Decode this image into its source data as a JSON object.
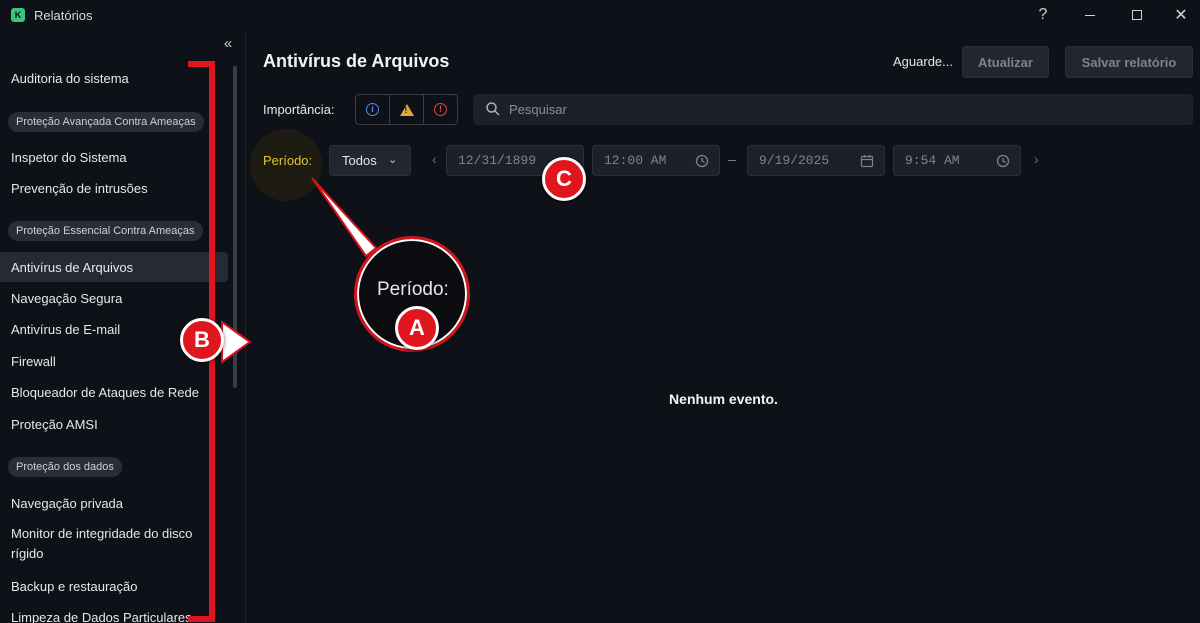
{
  "window": {
    "title": "Relatórios",
    "logo_letter": "K",
    "help_label": "?",
    "close_label": "✕"
  },
  "sidebar": {
    "collapse_label": "«",
    "items": [
      {
        "type": "item",
        "label": "Auditoria do sistema"
      },
      {
        "type": "group",
        "label": "Proteção Avançada Contra Ameaças"
      },
      {
        "type": "item",
        "label": "Inspetor do Sistema"
      },
      {
        "type": "item",
        "label": "Prevenção de intrusões"
      },
      {
        "type": "group",
        "label": "Proteção Essencial Contra Ameaças"
      },
      {
        "type": "item",
        "label": "Antivírus de Arquivos",
        "active": true
      },
      {
        "type": "item",
        "label": "Navegação Segura"
      },
      {
        "type": "item",
        "label": "Antivírus de E-mail"
      },
      {
        "type": "item",
        "label": "Firewall"
      },
      {
        "type": "item",
        "label": "Bloqueador de Ataques de Rede"
      },
      {
        "type": "item",
        "label": "Proteção AMSI"
      },
      {
        "type": "group",
        "label": "Proteção dos dados"
      },
      {
        "type": "item",
        "label": "Navegação privada"
      },
      {
        "type": "item",
        "label": "Monitor de integridade do disco rígido"
      },
      {
        "type": "item",
        "label": "Backup e restauração"
      },
      {
        "type": "item",
        "label": "Limpeza de Dados Particulares"
      }
    ]
  },
  "main": {
    "title": "Antivírus de Arquivos",
    "status": "Aguarde...",
    "refresh_label": "Atualizar",
    "save_label": "Salvar relatório",
    "importance_label": "Importância:",
    "search_placeholder": "Pesquisar",
    "period_label": "Período:",
    "period_select": "Todos",
    "start_date": "12/31/1899",
    "start_time": "12:00 AM",
    "end_date": "9/19/2025",
    "end_time": "9:54 AM",
    "range_dash": "–",
    "empty_message": "Nenhum evento."
  },
  "annotations": {
    "magnifier_text": "Período:",
    "badge_a": "A",
    "badge_b": "B",
    "badge_c": "C",
    "color": "#e0151d"
  }
}
